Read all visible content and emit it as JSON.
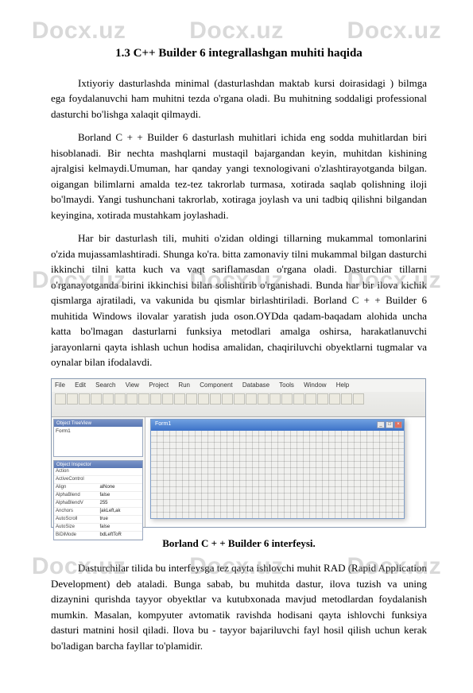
{
  "watermark": "Docx.uz",
  "title": "1.3  C++ Builder 6 integrallashgan  muhiti  haqida",
  "p1": "Ixtiyoriy dasturlashda minimal (dasturlashdan maktab kursi doirasidagi ) bilmga ega foydalanuvchi ham muhitni tezda o'rgana oladi. Bu muhitning soddaligi professional dasturchi bo'lishga xalaqit qilmaydi.",
  "p2": "Borland C + + Builder 6 dasturlash muhitlari ichida eng sodda muhitlardan biri hisoblanadi. Bir nechta mashqlarni mustaqil bajargandan keyin, muhitdan kishining ajralgisi kelmaydi.Umuman, har qanday yangi texnologivani o'zlashtirayotganda bilgan. oigangan bilimlarni amalda tez-tez takrorlab turmasa, xotirada saqlab qolishning iloji bo'lmaydi. Yangi tushunchani takrorlab, xotiraga joylash va uni tadbiq qilishni bilgandan keyingina, xotirada mustahkam joylashadi.",
  "p3": "Har bir dasturlash tili, muhiti o'zidan oldingi tillarning mukammal tomonlarini o'zida mujassamlashtiradi. Shunga ko'ra. bitta zamonaviy tilni mukammal bilgan dasturchi ikkinchi tilni katta kuch va vaqt sariflamasdan o'rgana oladi. Dasturchiar tillarni o'rganayotganda birini ikkinchisi bilan solishtirib o'rganishadi. Bunda har bir ilova kichik qismlarga ajratiladi, va vakunida bu qismlar birlashtiriladi. Borland C + + Builder 6 muhitida Windows ilovalar yaratish juda oson.OYDda qadam-baqadam alohida uncha katta bo'lmagan dasturlarni funksiya metodlari amalga oshirsa, harakatlanuvchi jarayonlarni qayta ishlash uchun hodisa amalidan, chaqiriluvchi obyektlarni tugmalar va oynalar bilan ifodalavdi.",
  "caption": "Borland C + + Builder 6 interfeysi.",
  "p4": "Dasturchilar tilida bu interfeysga tez qayta ishlovchi muhit RAD (Rapid Application Development) deb ataladi. Bunga sabab, bu muhitda dastur, ilova tuzish va uning dizaynini qurishda tayyor obyektlar va kutubxonada mavjud metodlardan foydalanish mumkin. Masalan, kompyuter avtomatik ravishda hodisani qayta ishlovchi funksiya dasturi matnini hosil qiladi. Ilova bu - tayyor bajariluvchi fayl hosil qilish uchun kerak bo'ladigan barcha fayllar to'plamidir.",
  "ide": {
    "menu": [
      "File",
      "Edit",
      "Search",
      "View",
      "Project",
      "Run",
      "Component",
      "Database",
      "Tools",
      "Window",
      "Help"
    ],
    "panel1_title": "Object TreeView",
    "tree": [
      "Form1"
    ],
    "panel2_title": "Object Inspector",
    "props": [
      [
        "Action",
        ""
      ],
      [
        "ActiveControl",
        ""
      ],
      [
        "Align",
        "alNone"
      ],
      [
        "AlphaBlend",
        "false"
      ],
      [
        "AlphaBlendV",
        "255"
      ],
      [
        "Anchors",
        "[akLeft,ak"
      ],
      [
        "AutoScroll",
        "true"
      ],
      [
        "AutoSize",
        "false"
      ],
      [
        "BiDiMode",
        "bdLeftToR"
      ]
    ],
    "form_title": "Form1"
  }
}
